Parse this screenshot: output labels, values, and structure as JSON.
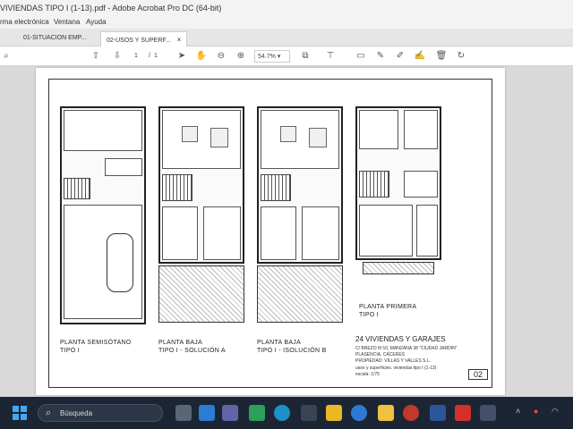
{
  "window": {
    "title": "VIVIENDAS TIPO I (1-13).pdf - Adobe Acrobat Pro DC (64-bit)"
  },
  "menu": [
    "rma electrónica",
    "Ventana",
    "Ayuda"
  ],
  "tabs": [
    {
      "label": "01-SITUACION EMP..."
    },
    {
      "label": "02-USOS Y SUPERF...",
      "close": "×"
    }
  ],
  "toolbar": {
    "page_current": "1",
    "page_sep": "/",
    "page_total": "1",
    "zoom": "54.7%",
    "zoom_caret": "▾"
  },
  "drawing": {
    "plans": [
      {
        "label_line1": "PLANTA SEMISÓTANO",
        "label_line2": "TIPO I"
      },
      {
        "label_line1": "PLANTA BAJA",
        "label_line2": "TIPO I - SOLUCIÓN A"
      },
      {
        "label_line1": "PLANTA BAJA",
        "label_line2": "TIPO I - ISOLUCIÓN B"
      },
      {
        "label_line1": "PLANTA PRIMERA",
        "label_line2": "TIPO I"
      }
    ],
    "title": "24 VIVIENDAS Y GARAJES",
    "address_line1": "C/ BREZO Nº10, MANZANA 38 \"CIUDAD JARDIN\"",
    "address_line2": "PLASENCIA. CÁCERES",
    "owner": "PROPIEDAD: VILLAS Y VALLES S.L.",
    "description": "usos y superficies. viviendas tipo I (1-13)",
    "scale": "escala: 1/75",
    "sheet_number": "02"
  },
  "taskbar": {
    "search_placeholder": "Búsqueda",
    "search_icon": "search-icon",
    "windows_icon": "windows-logo-icon"
  },
  "colors": {
    "taskbar": "#1c2533",
    "accent_blue": "#3fa9f5",
    "acrobat_red": "#d4302b"
  }
}
